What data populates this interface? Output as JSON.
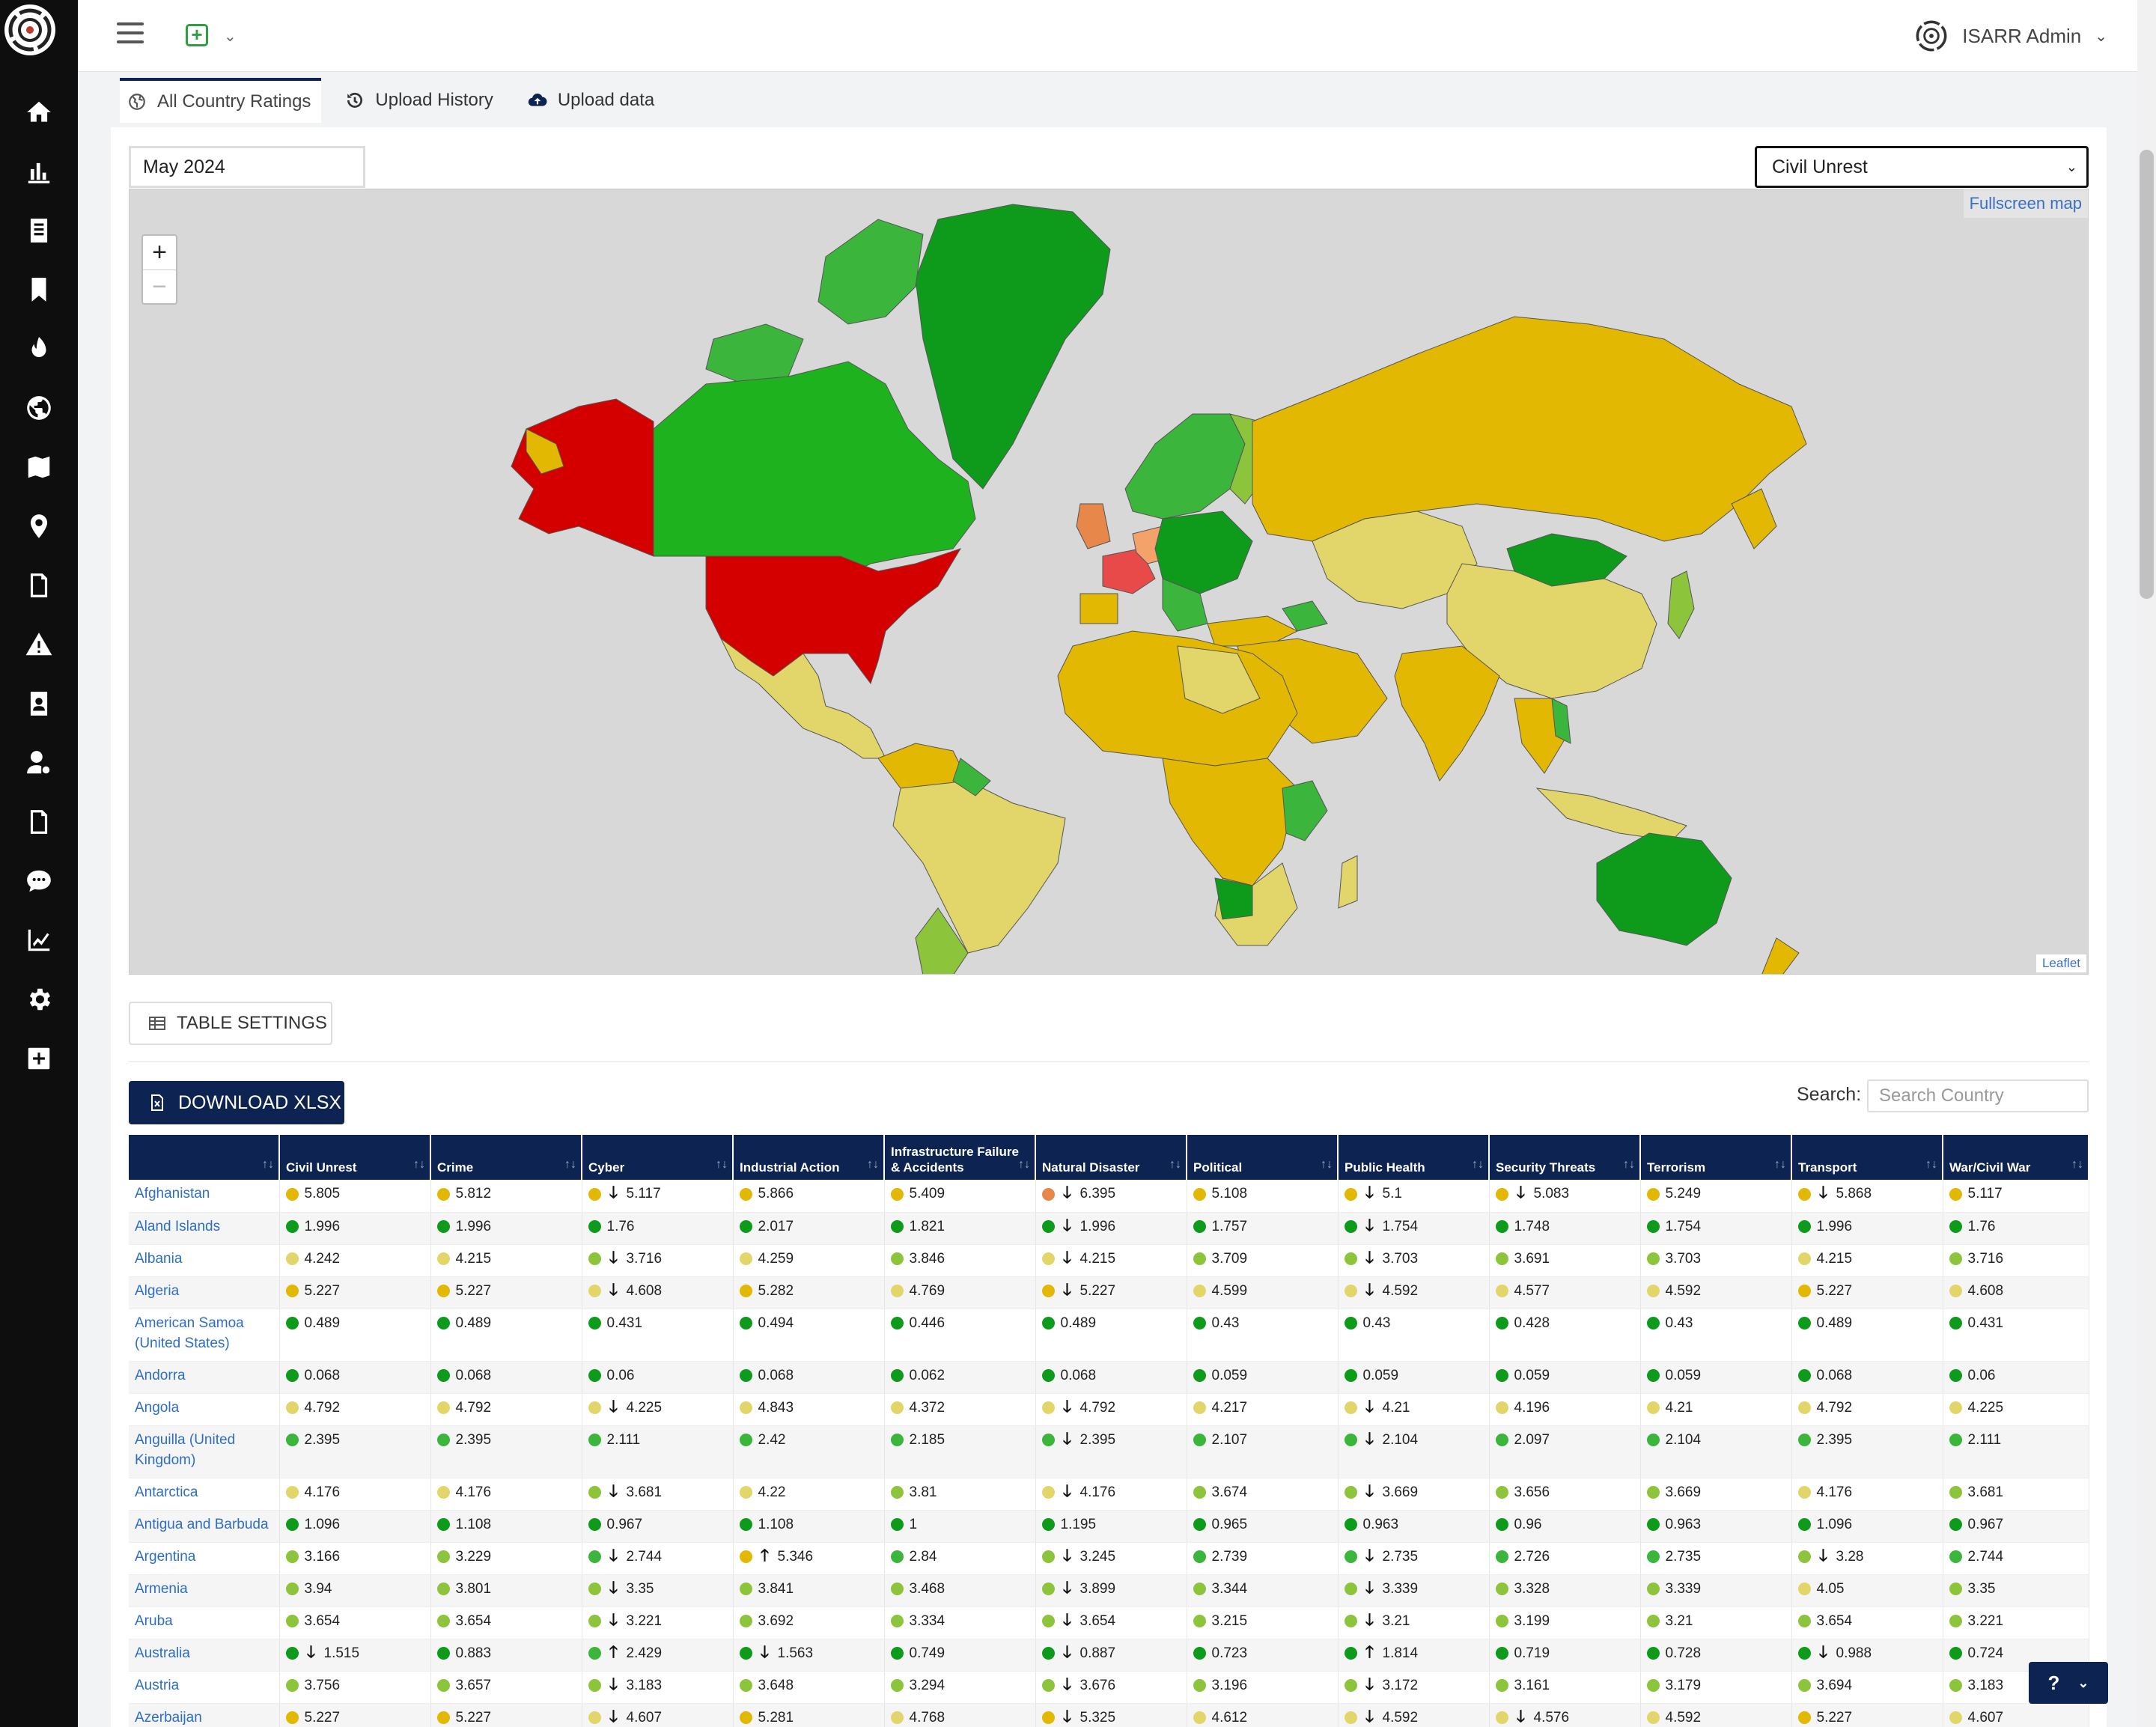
{
  "topbar": {
    "user_name": "ISARR Admin"
  },
  "tabs": [
    {
      "label": "All Country Ratings",
      "icon": "globe-icon"
    },
    {
      "label": "Upload History",
      "icon": "history-icon"
    },
    {
      "label": "Upload data",
      "icon": "cloud-upload-icon"
    }
  ],
  "filters": {
    "date": "May 2024",
    "category": "Civil Unrest"
  },
  "map": {
    "fullscreen_label": "Fullscreen map",
    "attribution": "Leaflet",
    "zoom_in": "+",
    "zoom_out": "−"
  },
  "table_settings_label": "TABLE SETTINGS",
  "download_label": "DOWNLOAD XLSX",
  "search": {
    "label": "Search:",
    "placeholder": "Search Country"
  },
  "colors": {
    "navy": "#0d2352",
    "dark_green": "#0e9b1c",
    "green": "#3cb53c",
    "light_green": "#8cc43c",
    "pale_yellow": "#e2d66a",
    "yellow": "#e2b803",
    "orange": "#e8874a",
    "red": "#d40000"
  },
  "table": {
    "columns": [
      "",
      "Civil Unrest",
      "Crime",
      "Cyber",
      "Industrial Action",
      "Infrastructure Failure & Accidents",
      "Natural Disaster",
      "Political",
      "Public Health",
      "Security Threats",
      "Terrorism",
      "Transport",
      "War/Civil War"
    ],
    "rows": [
      {
        "country": "Afghanistan",
        "cells": [
          [
            "y",
            "",
            "5.805"
          ],
          [
            "y",
            "",
            "5.812"
          ],
          [
            "y",
            "down",
            "5.117"
          ],
          [
            "y",
            "",
            "5.866"
          ],
          [
            "y",
            "",
            "5.409"
          ],
          [
            "o",
            "down",
            "6.395"
          ],
          [
            "y",
            "",
            "5.108"
          ],
          [
            "y",
            "down",
            "5.1"
          ],
          [
            "y",
            "down",
            "5.083"
          ],
          [
            "y",
            "",
            "5.249"
          ],
          [
            "y",
            "down",
            "5.868"
          ],
          [
            "y",
            "",
            "5.117"
          ]
        ]
      },
      {
        "country": "Aland Islands",
        "cells": [
          [
            "dg",
            "",
            "1.996"
          ],
          [
            "dg",
            "",
            "1.996"
          ],
          [
            "dg",
            "",
            "1.76"
          ],
          [
            "dg",
            "",
            "2.017"
          ],
          [
            "dg",
            "",
            "1.821"
          ],
          [
            "dg",
            "down",
            "1.996"
          ],
          [
            "dg",
            "",
            "1.757"
          ],
          [
            "dg",
            "down",
            "1.754"
          ],
          [
            "dg",
            "",
            "1.748"
          ],
          [
            "dg",
            "",
            "1.754"
          ],
          [
            "dg",
            "",
            "1.996"
          ],
          [
            "dg",
            "",
            "1.76"
          ]
        ]
      },
      {
        "country": "Albania",
        "cells": [
          [
            "py",
            "",
            "4.242"
          ],
          [
            "py",
            "",
            "4.215"
          ],
          [
            "lg",
            "down",
            "3.716"
          ],
          [
            "py",
            "",
            "4.259"
          ],
          [
            "lg",
            "",
            "3.846"
          ],
          [
            "py",
            "down",
            "4.215"
          ],
          [
            "lg",
            "",
            "3.709"
          ],
          [
            "lg",
            "down",
            "3.703"
          ],
          [
            "lg",
            "",
            "3.691"
          ],
          [
            "lg",
            "",
            "3.703"
          ],
          [
            "py",
            "",
            "4.215"
          ],
          [
            "lg",
            "",
            "3.716"
          ]
        ]
      },
      {
        "country": "Algeria",
        "cells": [
          [
            "y",
            "",
            "5.227"
          ],
          [
            "y",
            "",
            "5.227"
          ],
          [
            "py",
            "down",
            "4.608"
          ],
          [
            "y",
            "",
            "5.282"
          ],
          [
            "py",
            "",
            "4.769"
          ],
          [
            "y",
            "down",
            "5.227"
          ],
          [
            "py",
            "",
            "4.599"
          ],
          [
            "py",
            "down",
            "4.592"
          ],
          [
            "py",
            "",
            "4.577"
          ],
          [
            "py",
            "",
            "4.592"
          ],
          [
            "y",
            "",
            "5.227"
          ],
          [
            "py",
            "",
            "4.608"
          ]
        ]
      },
      {
        "country": "American Samoa (United States)",
        "tall": true,
        "cells": [
          [
            "dg",
            "",
            "0.489"
          ],
          [
            "dg",
            "",
            "0.489"
          ],
          [
            "dg",
            "",
            "0.431"
          ],
          [
            "dg",
            "",
            "0.494"
          ],
          [
            "dg",
            "",
            "0.446"
          ],
          [
            "dg",
            "",
            "0.489"
          ],
          [
            "dg",
            "",
            "0.43"
          ],
          [
            "dg",
            "",
            "0.43"
          ],
          [
            "dg",
            "",
            "0.428"
          ],
          [
            "dg",
            "",
            "0.43"
          ],
          [
            "dg",
            "",
            "0.489"
          ],
          [
            "dg",
            "",
            "0.431"
          ]
        ]
      },
      {
        "country": "Andorra",
        "cells": [
          [
            "dg",
            "",
            "0.068"
          ],
          [
            "dg",
            "",
            "0.068"
          ],
          [
            "dg",
            "",
            "0.06"
          ],
          [
            "dg",
            "",
            "0.068"
          ],
          [
            "dg",
            "",
            "0.062"
          ],
          [
            "dg",
            "",
            "0.068"
          ],
          [
            "dg",
            "",
            "0.059"
          ],
          [
            "dg",
            "",
            "0.059"
          ],
          [
            "dg",
            "",
            "0.059"
          ],
          [
            "dg",
            "",
            "0.059"
          ],
          [
            "dg",
            "",
            "0.068"
          ],
          [
            "dg",
            "",
            "0.06"
          ]
        ]
      },
      {
        "country": "Angola",
        "cells": [
          [
            "py",
            "",
            "4.792"
          ],
          [
            "py",
            "",
            "4.792"
          ],
          [
            "py",
            "down",
            "4.225"
          ],
          [
            "py",
            "",
            "4.843"
          ],
          [
            "py",
            "",
            "4.372"
          ],
          [
            "py",
            "down",
            "4.792"
          ],
          [
            "py",
            "",
            "4.217"
          ],
          [
            "py",
            "down",
            "4.21"
          ],
          [
            "py",
            "",
            "4.196"
          ],
          [
            "py",
            "",
            "4.21"
          ],
          [
            "py",
            "",
            "4.792"
          ],
          [
            "py",
            "",
            "4.225"
          ]
        ]
      },
      {
        "country": "Anguilla (United Kingdom)",
        "tall": true,
        "cells": [
          [
            "g",
            "",
            "2.395"
          ],
          [
            "g",
            "",
            "2.395"
          ],
          [
            "g",
            "",
            "2.111"
          ],
          [
            "g",
            "",
            "2.42"
          ],
          [
            "g",
            "",
            "2.185"
          ],
          [
            "g",
            "down",
            "2.395"
          ],
          [
            "g",
            "",
            "2.107"
          ],
          [
            "g",
            "down",
            "2.104"
          ],
          [
            "g",
            "",
            "2.097"
          ],
          [
            "g",
            "",
            "2.104"
          ],
          [
            "g",
            "",
            "2.395"
          ],
          [
            "g",
            "",
            "2.111"
          ]
        ]
      },
      {
        "country": "Antarctica",
        "cells": [
          [
            "py",
            "",
            "4.176"
          ],
          [
            "py",
            "",
            "4.176"
          ],
          [
            "lg",
            "down",
            "3.681"
          ],
          [
            "py",
            "",
            "4.22"
          ],
          [
            "lg",
            "",
            "3.81"
          ],
          [
            "py",
            "down",
            "4.176"
          ],
          [
            "lg",
            "",
            "3.674"
          ],
          [
            "lg",
            "down",
            "3.669"
          ],
          [
            "lg",
            "",
            "3.656"
          ],
          [
            "lg",
            "",
            "3.669"
          ],
          [
            "py",
            "",
            "4.176"
          ],
          [
            "lg",
            "",
            "3.681"
          ]
        ]
      },
      {
        "country": "Antigua and Barbuda",
        "cells": [
          [
            "dg",
            "",
            "1.096"
          ],
          [
            "dg",
            "",
            "1.108"
          ],
          [
            "dg",
            "",
            "0.967"
          ],
          [
            "dg",
            "",
            "1.108"
          ],
          [
            "dg",
            "",
            "1"
          ],
          [
            "dg",
            "",
            "1.195"
          ],
          [
            "dg",
            "",
            "0.965"
          ],
          [
            "dg",
            "",
            "0.963"
          ],
          [
            "dg",
            "",
            "0.96"
          ],
          [
            "dg",
            "",
            "0.963"
          ],
          [
            "dg",
            "",
            "1.096"
          ],
          [
            "dg",
            "",
            "0.967"
          ]
        ]
      },
      {
        "country": "Argentina",
        "cells": [
          [
            "lg",
            "",
            "3.166"
          ],
          [
            "lg",
            "",
            "3.229"
          ],
          [
            "g",
            "down",
            "2.744"
          ],
          [
            "y",
            "up",
            "5.346"
          ],
          [
            "g",
            "",
            "2.84"
          ],
          [
            "lg",
            "down",
            "3.245"
          ],
          [
            "g",
            "",
            "2.739"
          ],
          [
            "g",
            "down",
            "2.735"
          ],
          [
            "g",
            "",
            "2.726"
          ],
          [
            "g",
            "",
            "2.735"
          ],
          [
            "lg",
            "down",
            "3.28"
          ],
          [
            "g",
            "",
            "2.744"
          ]
        ]
      },
      {
        "country": "Armenia",
        "cells": [
          [
            "lg",
            "",
            "3.94"
          ],
          [
            "lg",
            "",
            "3.801"
          ],
          [
            "lg",
            "down",
            "3.35"
          ],
          [
            "lg",
            "",
            "3.841"
          ],
          [
            "lg",
            "",
            "3.468"
          ],
          [
            "lg",
            "down",
            "3.899"
          ],
          [
            "lg",
            "",
            "3.344"
          ],
          [
            "lg",
            "down",
            "3.339"
          ],
          [
            "lg",
            "",
            "3.328"
          ],
          [
            "lg",
            "",
            "3.339"
          ],
          [
            "py",
            "",
            "4.05"
          ],
          [
            "lg",
            "",
            "3.35"
          ]
        ]
      },
      {
        "country": "Aruba",
        "cells": [
          [
            "lg",
            "",
            "3.654"
          ],
          [
            "lg",
            "",
            "3.654"
          ],
          [
            "lg",
            "down",
            "3.221"
          ],
          [
            "lg",
            "",
            "3.692"
          ],
          [
            "lg",
            "",
            "3.334"
          ],
          [
            "lg",
            "down",
            "3.654"
          ],
          [
            "lg",
            "",
            "3.215"
          ],
          [
            "lg",
            "down",
            "3.21"
          ],
          [
            "lg",
            "",
            "3.199"
          ],
          [
            "lg",
            "",
            "3.21"
          ],
          [
            "lg",
            "",
            "3.654"
          ],
          [
            "lg",
            "",
            "3.221"
          ]
        ]
      },
      {
        "country": "Australia",
        "cells": [
          [
            "dg",
            "down",
            "1.515"
          ],
          [
            "dg",
            "",
            "0.883"
          ],
          [
            "g",
            "up",
            "2.429"
          ],
          [
            "dg",
            "down",
            "1.563"
          ],
          [
            "dg",
            "",
            "0.749"
          ],
          [
            "dg",
            "down",
            "0.887"
          ],
          [
            "dg",
            "",
            "0.723"
          ],
          [
            "dg",
            "up",
            "1.814"
          ],
          [
            "dg",
            "",
            "0.719"
          ],
          [
            "dg",
            "",
            "0.728"
          ],
          [
            "dg",
            "down",
            "0.988"
          ],
          [
            "dg",
            "",
            "0.724"
          ]
        ]
      },
      {
        "country": "Austria",
        "cells": [
          [
            "lg",
            "",
            "3.756"
          ],
          [
            "lg",
            "",
            "3.657"
          ],
          [
            "lg",
            "down",
            "3.183"
          ],
          [
            "lg",
            "",
            "3.648"
          ],
          [
            "lg",
            "",
            "3.294"
          ],
          [
            "lg",
            "down",
            "3.676"
          ],
          [
            "lg",
            "",
            "3.196"
          ],
          [
            "lg",
            "down",
            "3.172"
          ],
          [
            "lg",
            "",
            "3.161"
          ],
          [
            "lg",
            "",
            "3.179"
          ],
          [
            "lg",
            "",
            "3.694"
          ],
          [
            "lg",
            "",
            "3.183"
          ]
        ]
      },
      {
        "country": "Azerbaijan",
        "cells": [
          [
            "y",
            "",
            "5.227"
          ],
          [
            "y",
            "",
            "5.227"
          ],
          [
            "py",
            "down",
            "4.607"
          ],
          [
            "y",
            "",
            "5.281"
          ],
          [
            "py",
            "",
            "4.768"
          ],
          [
            "y",
            "down",
            "5.325"
          ],
          [
            "py",
            "",
            "4.612"
          ],
          [
            "py",
            "down",
            "4.592"
          ],
          [
            "py",
            "down",
            "4.576"
          ],
          [
            "py",
            "",
            "4.592"
          ],
          [
            "y",
            "",
            "5.227"
          ],
          [
            "py",
            "",
            "4.607"
          ]
        ]
      }
    ]
  }
}
